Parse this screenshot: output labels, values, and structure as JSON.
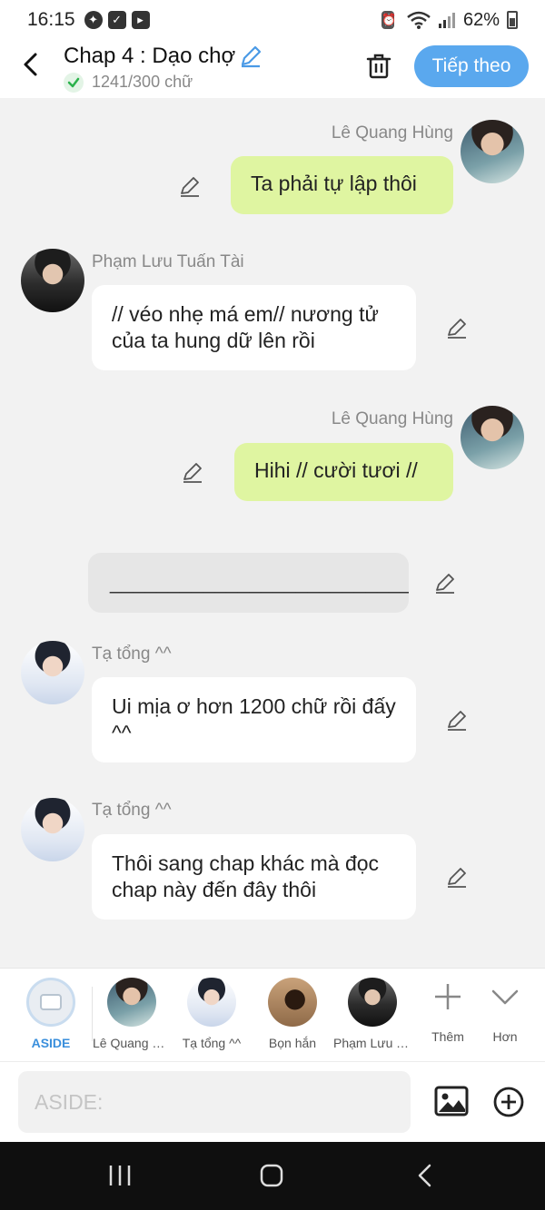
{
  "status_bar": {
    "time": "16:15",
    "battery": "62%"
  },
  "header": {
    "title": "Chap 4 : Dạo chợ",
    "word_count": "1241/300 chữ",
    "next_button": "Tiếp theo"
  },
  "messages": [
    {
      "sender": "Lê Quang Hùng",
      "text": "Ta phải tự lập thôi",
      "side": "right"
    },
    {
      "sender": "Phạm Lưu Tuấn Tài",
      "text": "// véo nhẹ má em// nương tử của ta hung dữ lên rồi",
      "side": "left"
    },
    {
      "sender": "Lê Quang Hùng",
      "text": "Hihi // cười tươi //",
      "side": "right"
    },
    {
      "sender": "",
      "text": "______________________________",
      "side": "center"
    },
    {
      "sender": "Tạ tổng ^^",
      "text": "Ui mịa ơ hơn 1200 chữ rồi đấy ^^",
      "side": "left"
    },
    {
      "sender": "Tạ tổng ^^",
      "text": "Thôi sang chap khác mà đọc chap này đến đây thôi",
      "side": "left"
    }
  ],
  "characters": [
    {
      "label": "ASIDE"
    },
    {
      "label": "Lê Quang Hùng"
    },
    {
      "label": "Tạ tổng ^^"
    },
    {
      "label": "Bọn hắn"
    },
    {
      "label": "Phạm Lưu Tuấn Tài"
    }
  ],
  "tools": {
    "more_label": "Thêm",
    "less_label": "Hơn"
  },
  "input": {
    "placeholder": "ASIDE:"
  },
  "colors": {
    "accent": "#5aa8ee",
    "bubble_green": "#dff5a1",
    "bubble_white": "#ffffff",
    "bubble_gray": "#e6e6e6"
  },
  "icons": [
    "back-icon",
    "pencil-icon",
    "check-icon",
    "trash-icon",
    "plus-icon",
    "chevron-down-icon",
    "image-icon",
    "add-circle-icon"
  ]
}
